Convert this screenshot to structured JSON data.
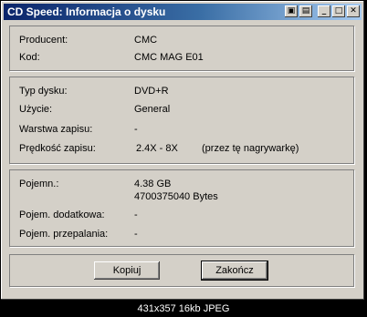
{
  "window": {
    "title": "CD Speed: Informacja o dysku",
    "buttons": [
      "▣",
      "▤",
      "_",
      "□",
      "✕"
    ]
  },
  "disc": {
    "producer_label": "Producent:",
    "producer_value": "CMC",
    "code_label": "Kod:",
    "code_value": "CMC MAG E01"
  },
  "format": {
    "type_label": "Typ dysku:",
    "type_value": "DVD+R",
    "usage_label": "Użycie:",
    "usage_value": "General",
    "layer_label": "Warstwa zapisu:",
    "layer_value": "-",
    "speed_label": "Prędkość zapisu:",
    "speed_value": "2.4X - 8X",
    "speed_note": "(przez tę nagrywarkę)"
  },
  "capacity": {
    "capacity_label": "Pojemn.:",
    "capacity_gb": "4.38 GB",
    "capacity_bytes": "4700375040 Bytes",
    "extra_label": "Pojem. dodatkowa:",
    "extra_value": "-",
    "overburn_label": "Pojem. przepalania:",
    "overburn_value": "-"
  },
  "actions": {
    "copy_label": "Kopiuj",
    "close_label": "Zakończ"
  },
  "footer": "431x357 16kb JPEG"
}
